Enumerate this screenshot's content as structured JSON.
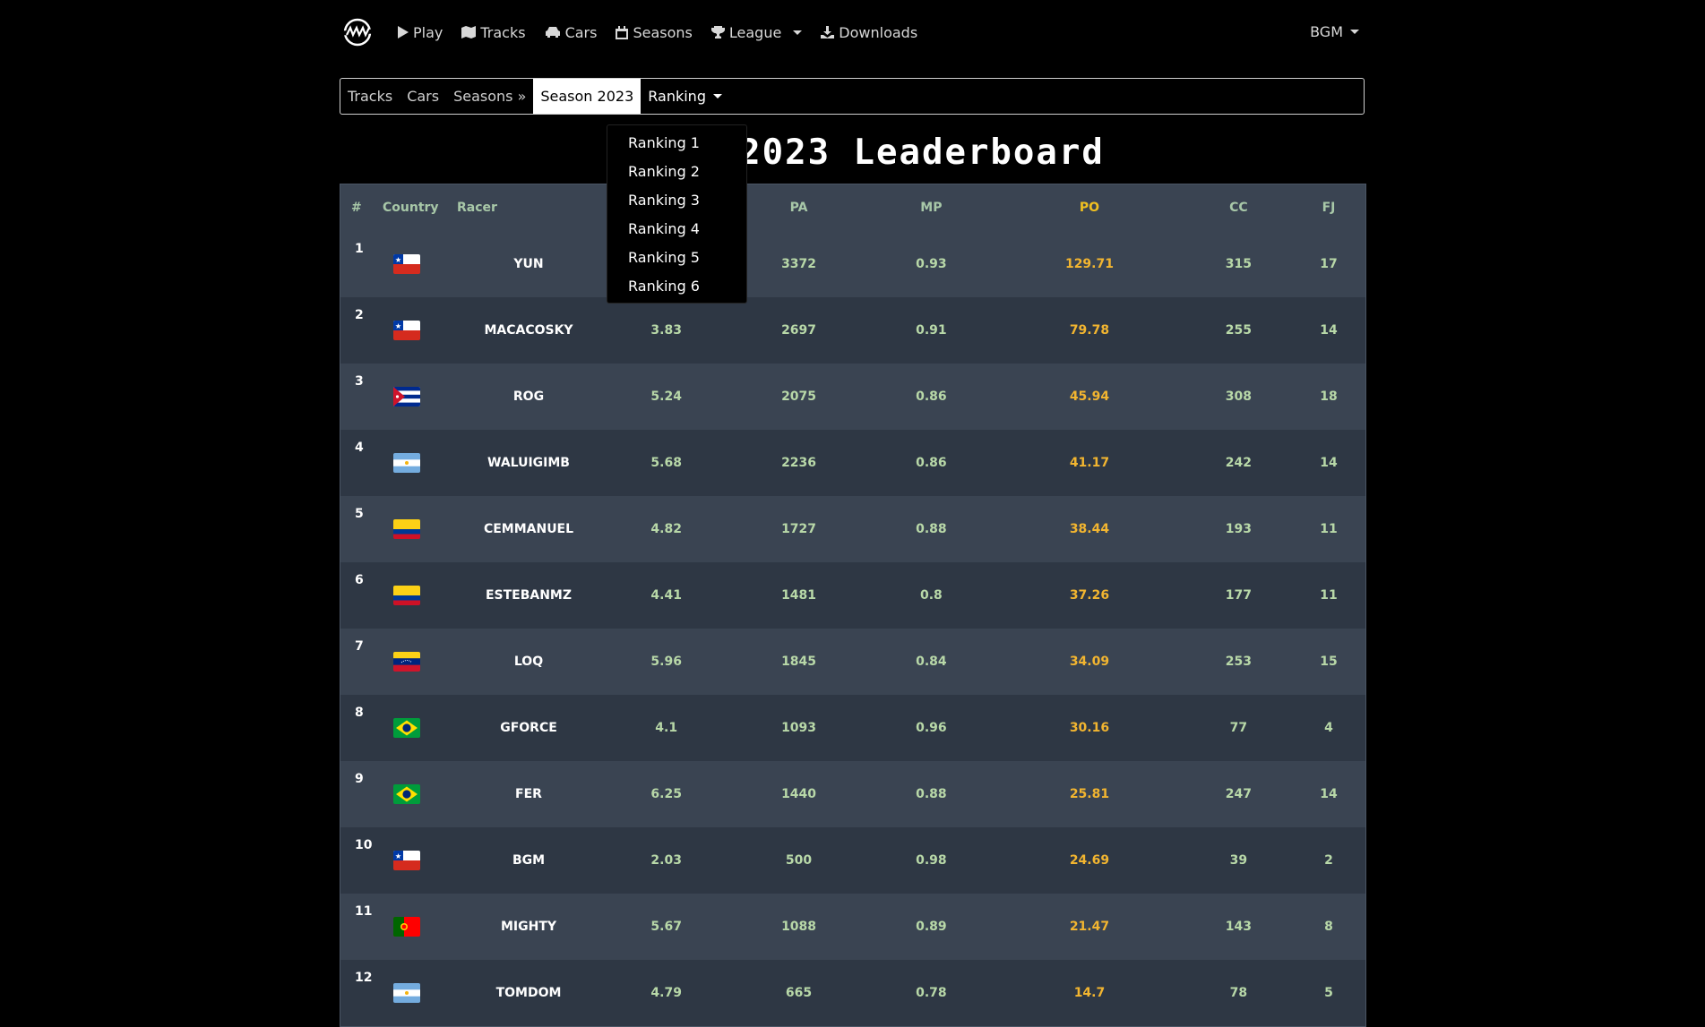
{
  "navbar": {
    "items": [
      {
        "label": "Play",
        "icon": "play-icon"
      },
      {
        "label": "Tracks",
        "icon": "map-icon"
      },
      {
        "label": "Cars",
        "icon": "car-icon"
      },
      {
        "label": "Seasons",
        "icon": "calendar-icon"
      },
      {
        "label": "League",
        "icon": "trophy-icon"
      },
      {
        "label": "Downloads",
        "icon": "download-icon"
      }
    ],
    "user": "BGM"
  },
  "subnav": {
    "tracks": "Tracks",
    "cars": "Cars",
    "seasons": "Seasons »",
    "season": "Season 2023",
    "ranking": "Ranking"
  },
  "dropdown": [
    "Ranking 1",
    "Ranking 2",
    "Ranking 3",
    "Ranking 4",
    "Ranking 5",
    "Ranking 6"
  ],
  "title": "2023 Leaderboard",
  "table": {
    "headers": {
      "rank": "#",
      "country": "Country",
      "racer": "Racer",
      "pa": "PA",
      "mp": "MP",
      "po": "PO",
      "cc": "CC",
      "fj": "FJ"
    },
    "rows": [
      {
        "rank": "1",
        "country": "chile",
        "racer": "YUN",
        "avg": "",
        "pa": "3372",
        "mp": "0.93",
        "po": "129.71",
        "cc": "315",
        "fj": "17"
      },
      {
        "rank": "2",
        "country": "chile",
        "racer": "MACACOSKY",
        "avg": "3.83",
        "pa": "2697",
        "mp": "0.91",
        "po": "79.78",
        "cc": "255",
        "fj": "14"
      },
      {
        "rank": "3",
        "country": "cuba",
        "racer": "ROG",
        "avg": "5.24",
        "pa": "2075",
        "mp": "0.86",
        "po": "45.94",
        "cc": "308",
        "fj": "18"
      },
      {
        "rank": "4",
        "country": "argentina",
        "racer": "WALUIGIMB",
        "avg": "5.68",
        "pa": "2236",
        "mp": "0.86",
        "po": "41.17",
        "cc": "242",
        "fj": "14"
      },
      {
        "rank": "5",
        "country": "colombia",
        "racer": "CEMMANUEL",
        "avg": "4.82",
        "pa": "1727",
        "mp": "0.88",
        "po": "38.44",
        "cc": "193",
        "fj": "11"
      },
      {
        "rank": "6",
        "country": "colombia",
        "racer": "ESTEBANMZ",
        "avg": "4.41",
        "pa": "1481",
        "mp": "0.8",
        "po": "37.26",
        "cc": "177",
        "fj": "11"
      },
      {
        "rank": "7",
        "country": "venezuela",
        "racer": "LOQ",
        "avg": "5.96",
        "pa": "1845",
        "mp": "0.84",
        "po": "34.09",
        "cc": "253",
        "fj": "15"
      },
      {
        "rank": "8",
        "country": "brazil",
        "racer": "GFORCE",
        "avg": "4.1",
        "pa": "1093",
        "mp": "0.96",
        "po": "30.16",
        "cc": "77",
        "fj": "4"
      },
      {
        "rank": "9",
        "country": "brazil",
        "racer": "FER",
        "avg": "6.25",
        "pa": "1440",
        "mp": "0.88",
        "po": "25.81",
        "cc": "247",
        "fj": "14"
      },
      {
        "rank": "10",
        "country": "chile",
        "racer": "BGM",
        "avg": "2.03",
        "pa": "500",
        "mp": "0.98",
        "po": "24.69",
        "cc": "39",
        "fj": "2"
      },
      {
        "rank": "11",
        "country": "portugal",
        "racer": "MIGHTY",
        "avg": "5.67",
        "pa": "1088",
        "mp": "0.89",
        "po": "21.47",
        "cc": "143",
        "fj": "8"
      },
      {
        "rank": "12",
        "country": "argentina",
        "racer": "TOMDOM",
        "avg": "4.79",
        "pa": "665",
        "mp": "0.78",
        "po": "14.7",
        "cc": "78",
        "fj": "5"
      }
    ]
  }
}
